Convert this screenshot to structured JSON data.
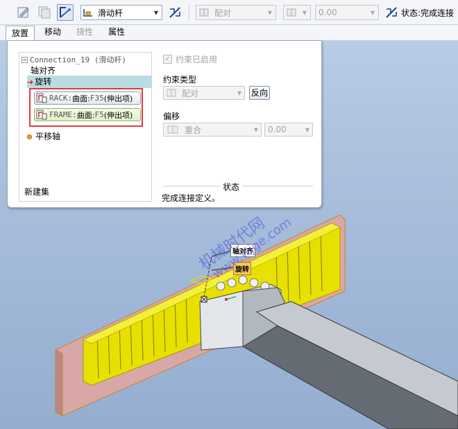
{
  "toolbar": {
    "motion_type": "滑动杆",
    "constraint_type": "配对",
    "offset_value": "0.00",
    "status_label": "状态:完成连接"
  },
  "tabs": [
    {
      "label": "放置"
    },
    {
      "label": "移动"
    },
    {
      "label": "挠性"
    },
    {
      "label": "属性"
    }
  ],
  "tree": {
    "connection": "Connection_19 (滑动杆)",
    "axis_align": "轴对齐",
    "rotate": "旋转",
    "ref1_prefix": "RACK:",
    "ref1_main": "曲面:",
    "ref1_code": "F35",
    "ref1_suffix": "(伸出项)",
    "ref2_prefix": "FRAME:",
    "ref2_main": "曲面:",
    "ref2_code": "F5",
    "ref2_suffix": "(伸出项)",
    "translate_axis": "平移轴",
    "new_set": "新建集"
  },
  "options": {
    "constraint_enabled": "约束已启用",
    "constraint_type_label": "约束类型",
    "constraint_type_value": "配对",
    "flip_button": "反向",
    "offset_label": "偏移",
    "offset_type_value": "重合",
    "offset_value": "0.00",
    "status_title": "状态",
    "status_message": "完成连接定义。"
  },
  "viewport": {
    "callout_axis": "轴对齐",
    "callout_rotate": "旋转",
    "watermark_1": "机械时代网",
    "watermark_2": "www.wjge.com"
  },
  "colors": {
    "accent_red": "#e23a3a",
    "selection_bg": "#b9dde2",
    "rack_yellow": "#e8e000",
    "frame_pink": "#d9a7a7",
    "part_gray": "#8f98a3"
  }
}
